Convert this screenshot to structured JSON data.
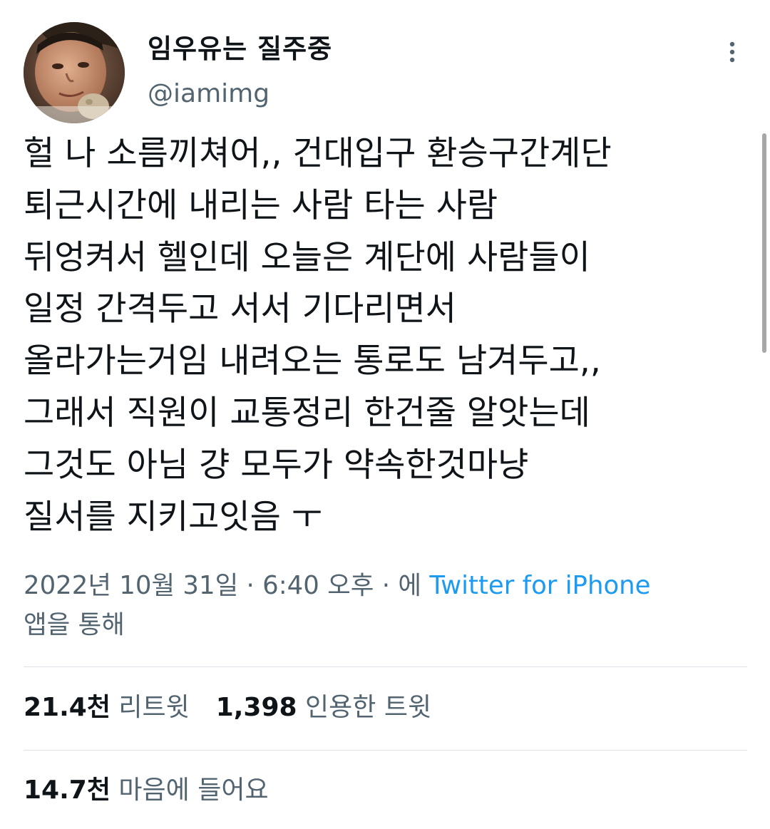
{
  "author": {
    "display_name": "임우유는 질주중",
    "handle": "@iamimg"
  },
  "tweet": {
    "lines": [
      "헐 나 소름끼쳐어,, 건대입구 환승구간계단",
      "퇴근시간에 내리는 사람 타는 사람",
      "뒤엉켜서 헬인데 오늘은 계단에 사람들이",
      "일정 간격두고 서서 기다리면서",
      "올라가는거임 내려오는 통로도 남겨두고,,",
      "그래서 직원이 교통정리 한건줄 알앗는데",
      "그것도 아님 걍 모두가 약속한것마냥",
      "질서를 지키고잇음 ㅜ"
    ]
  },
  "meta": {
    "date": "2022년 10월 31일",
    "separator": "·",
    "time": "6:40 오후",
    "via_prefix": "에",
    "source": "Twitter for iPhone",
    "via_suffix": "앱을 통해"
  },
  "stats": {
    "retweets_count": "21.4천",
    "retweets_label": "리트윗",
    "quotes_count": "1,398",
    "quotes_label": "인용한 트윗",
    "likes_count": "14.7천",
    "likes_label": "마음에 들어요"
  },
  "icons": {
    "more": "more-vertical-icon"
  },
  "colors": {
    "text": "#0f1419",
    "secondary": "#536471",
    "link": "#1d9bf0",
    "divider": "#dfe3e7"
  }
}
